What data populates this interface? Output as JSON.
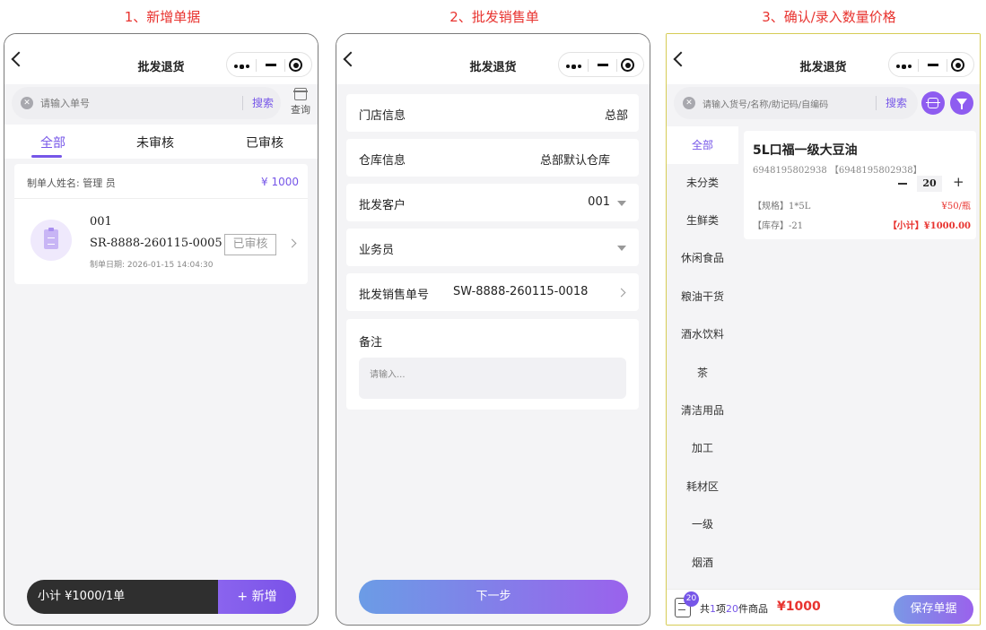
{
  "steps": {
    "s1": "1、新增单据",
    "s2": "2、批发销售单",
    "s3": "3、确认/录入数量价格"
  },
  "phone1": {
    "title": "批发退货",
    "search_placeholder": "请输入单号",
    "search_button": "搜索",
    "query_label": "查询",
    "tabs": [
      "全部",
      "未审核",
      "已审核"
    ],
    "card": {
      "maker": "制单人姓名: 管理 员",
      "amount": "¥ 1000",
      "code": "001",
      "order_no": "SR-8888-260115-0005",
      "date": "制单日期: 2026-01-15 14:04:30",
      "status": "已审核"
    },
    "subtotal": "小计 ¥1000/1单",
    "add_button": "+ 新增"
  },
  "phone2": {
    "title": "批发退货",
    "fields": [
      {
        "label": "门店信息",
        "value": "总部"
      },
      {
        "label": "仓库信息",
        "value": "总部默认仓库"
      },
      {
        "label": "批发客户",
        "value": "001"
      },
      {
        "label": "业务员",
        "value": ""
      },
      {
        "label": "批发销售单号",
        "value": "SW-8888-260115-0018"
      }
    ],
    "remark_label": "备注",
    "remark_placeholder": "请输入...",
    "next_button": "下一步"
  },
  "phone3": {
    "title": "批发退货",
    "search_placeholder": "请输入货号/名称/助记码/自编码",
    "search_button": "搜索",
    "categories": [
      "全部",
      "未分类",
      "生鲜类",
      "休闲食品",
      "粮油干货",
      "酒水饮料",
      "茶",
      "清洁用品",
      "加工",
      "耗材区",
      "一级",
      "烟酒"
    ],
    "product": {
      "name": "5L口福一级大豆油",
      "code": "6948195802938 【6948195802938】",
      "qty": "20",
      "spec": "【规格】1*5L",
      "price": "¥50/瓶",
      "stock": "【库存】-21",
      "subtotal": "【小计】¥1000.00"
    },
    "cart_badge": "20",
    "summary_pre": "共",
    "summary_items": "1",
    "summary_mid": "项",
    "summary_count": "20",
    "summary_post": "件商品",
    "total": "¥1000",
    "save_button": "保存单据"
  },
  "colors": {
    "accent": "#7656e8",
    "price_red": "#e8332f",
    "step_title": "#e8332f"
  }
}
